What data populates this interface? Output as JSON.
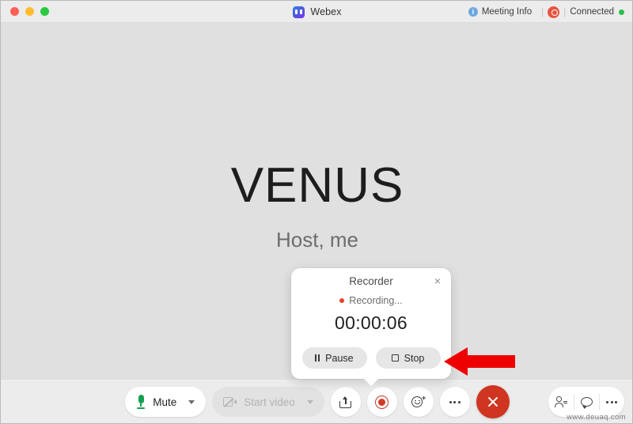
{
  "window": {
    "title": "Webex",
    "logo_icon": "webex-logo-icon",
    "traffic_lights": {
      "close": "close-window-button",
      "minimize": "minimize-window-button",
      "maximize": "maximize-window-button"
    }
  },
  "titlebar": {
    "meeting_info_label": "Meeting Info",
    "info_icon_glyph": "i",
    "recording_badge_icon": "recording-indicator-icon",
    "connected_label": "Connected",
    "separator": "|"
  },
  "stage": {
    "participant_name": "VENUS",
    "participant_role": "Host, me"
  },
  "recorder": {
    "title": "Recorder",
    "close_glyph": "×",
    "status_label": "Recording...",
    "timer": "00:00:06",
    "pause_label": "Pause",
    "stop_label": "Stop",
    "status_color": "#e8452c"
  },
  "controls": {
    "mute_label": "Mute",
    "mute_icon": "microphone-icon",
    "start_video_label": "Start video",
    "start_video_icon": "camera-off-icon",
    "share_icon": "share-screen-icon",
    "record_icon": "record-icon",
    "reaction_icon": "reactions-icon",
    "more_icon": "more-options-icon",
    "end_icon": "end-meeting-icon",
    "participants_icon": "participants-icon",
    "chat_icon": "chat-icon",
    "right_more_icon": "more-panels-icon"
  },
  "annotation": {
    "arrow_color": "#ee0000",
    "arrow_direction": "left",
    "points_at": "stop-button"
  },
  "watermark": {
    "text": "www.deuaq.com"
  },
  "colors": {
    "stage_background": "#e0e0e0",
    "bar_background": "#ececec",
    "accent_red": "#cf3520",
    "accent_green": "#12a150",
    "brand_blue": "#2d7ff9"
  }
}
